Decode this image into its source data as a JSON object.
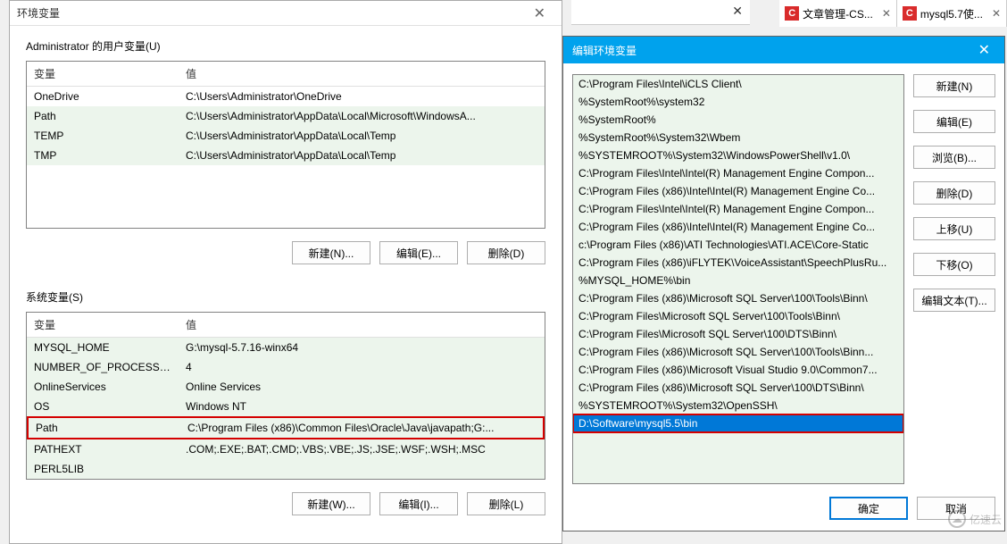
{
  "tabs": [
    {
      "icon": "C",
      "label": "文章管理-CS..."
    },
    {
      "icon": "C",
      "label": "mysql5.7使..."
    }
  ],
  "dlg1": {
    "title": "环境变量",
    "userSectionLabel": "Administrator 的用户变量(U)",
    "sysSectionLabel": "系统变量(S)",
    "headers": {
      "var": "变量",
      "val": "值"
    },
    "userVars": [
      {
        "name": "OneDrive",
        "value": "C:\\Users\\Administrator\\OneDrive"
      },
      {
        "name": "Path",
        "value": "C:\\Users\\Administrator\\AppData\\Local\\Microsoft\\WindowsA..."
      },
      {
        "name": "TEMP",
        "value": "C:\\Users\\Administrator\\AppData\\Local\\Temp"
      },
      {
        "name": "TMP",
        "value": "C:\\Users\\Administrator\\AppData\\Local\\Temp"
      }
    ],
    "sysVars": [
      {
        "name": "MYSQL_HOME",
        "value": "G:\\mysql-5.7.16-winx64"
      },
      {
        "name": "NUMBER_OF_PROCESSORS",
        "value": "4"
      },
      {
        "name": "OnlineServices",
        "value": "Online Services"
      },
      {
        "name": "OS",
        "value": "Windows NT"
      },
      {
        "name": "Path",
        "value": "C:\\Program Files (x86)\\Common Files\\Oracle\\Java\\javapath;G:...",
        "selected": true
      },
      {
        "name": "PATHEXT",
        "value": ".COM;.EXE;.BAT;.CMD;.VBS;.VBE;.JS;.JSE;.WSF;.WSH;.MSC"
      },
      {
        "name": "PERL5LIB",
        "value": ""
      }
    ],
    "btns": {
      "newU": "新建(N)...",
      "editU": "编辑(E)...",
      "delU": "删除(D)",
      "newS": "新建(W)...",
      "editS": "编辑(I)...",
      "delS": "删除(L)"
    }
  },
  "dlg2": {
    "title": "编辑环境变量",
    "items": [
      "C:\\Program Files\\Intel\\iCLS Client\\",
      "%SystemRoot%\\system32",
      "%SystemRoot%",
      "%SystemRoot%\\System32\\Wbem",
      "%SYSTEMROOT%\\System32\\WindowsPowerShell\\v1.0\\",
      "C:\\Program Files\\Intel\\Intel(R) Management Engine Compon...",
      "C:\\Program Files (x86)\\Intel\\Intel(R) Management Engine Co...",
      "C:\\Program Files\\Intel\\Intel(R) Management Engine Compon...",
      "C:\\Program Files (x86)\\Intel\\Intel(R) Management Engine Co...",
      "c:\\Program Files (x86)\\ATI Technologies\\ATI.ACE\\Core-Static",
      "C:\\Program Files (x86)\\iFLYTEK\\VoiceAssistant\\SpeechPlusRu...",
      "%MYSQL_HOME%\\bin",
      "C:\\Program Files (x86)\\Microsoft SQL Server\\100\\Tools\\Binn\\",
      "C:\\Program Files\\Microsoft SQL Server\\100\\Tools\\Binn\\",
      "C:\\Program Files\\Microsoft SQL Server\\100\\DTS\\Binn\\",
      "C:\\Program Files (x86)\\Microsoft SQL Server\\100\\Tools\\Binn...",
      "C:\\Program Files (x86)\\Microsoft Visual Studio 9.0\\Common7...",
      "C:\\Program Files (x86)\\Microsoft SQL Server\\100\\DTS\\Binn\\",
      "%SYSTEMROOT%\\System32\\OpenSSH\\",
      "D:\\Software\\mysql5.5\\bin"
    ],
    "selectedIndex": 19,
    "sideBtns": {
      "new": "新建(N)",
      "edit": "编辑(E)",
      "browse": "浏览(B)...",
      "del": "删除(D)",
      "up": "上移(U)",
      "down": "下移(O)",
      "editText": "编辑文本(T)..."
    },
    "bottom": {
      "ok": "确定",
      "cancel": "取消"
    }
  },
  "watermark": "亿速云"
}
